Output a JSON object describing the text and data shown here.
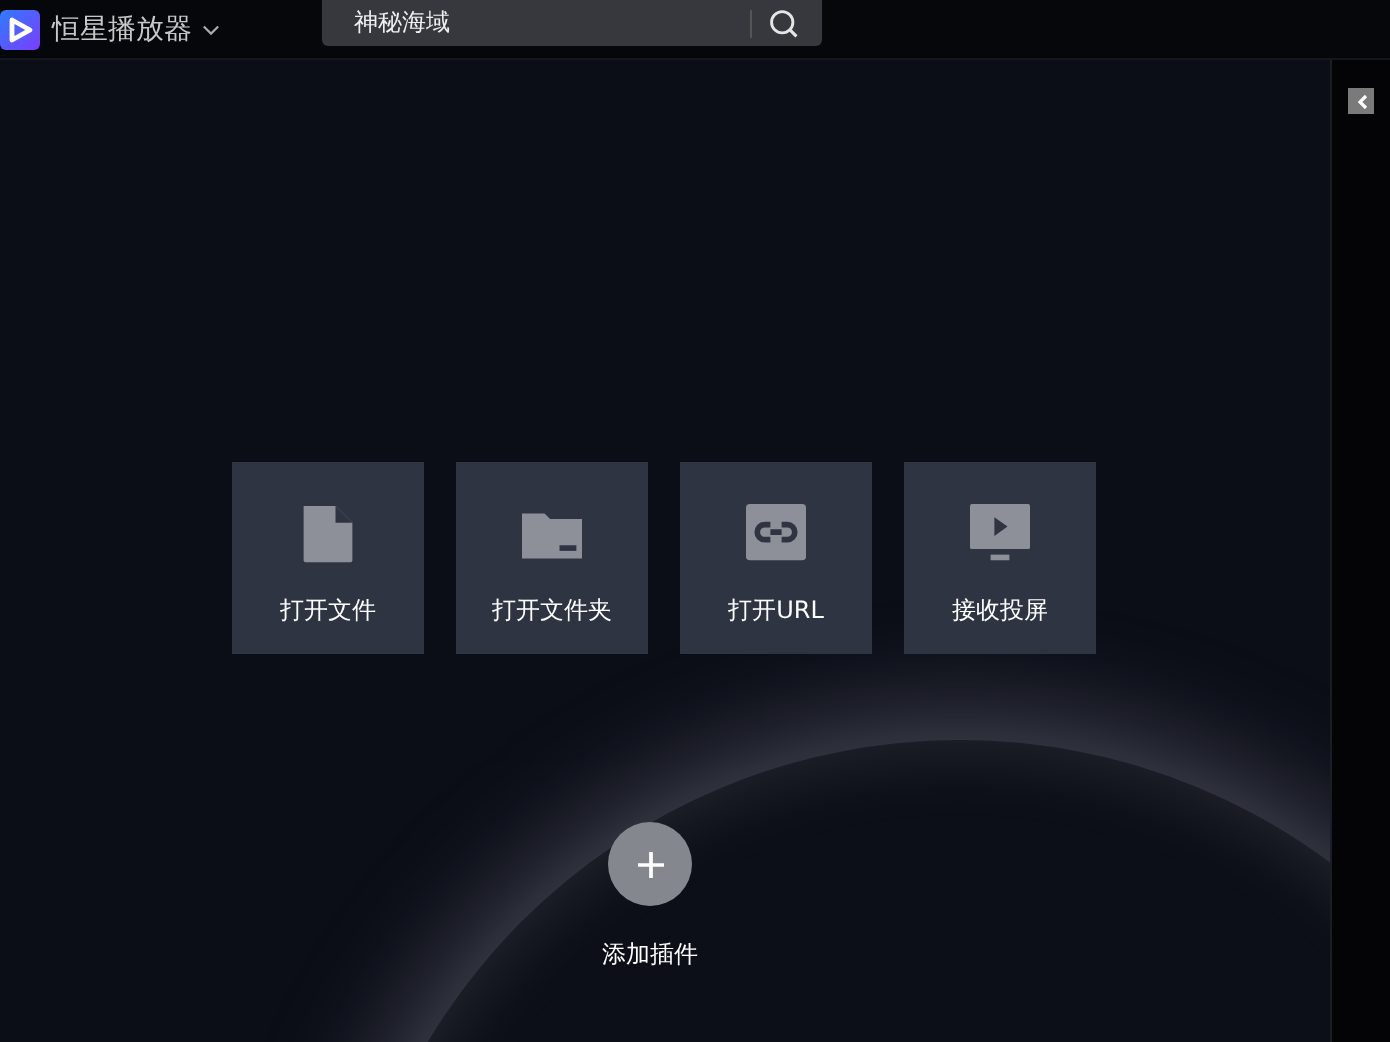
{
  "app": {
    "title": "恒星播放器"
  },
  "search": {
    "value": "神秘海域"
  },
  "actions": [
    {
      "kind": "file",
      "label": "打开文件"
    },
    {
      "kind": "folder",
      "label": "打开文件夹"
    },
    {
      "kind": "url",
      "label": "打开URL"
    },
    {
      "kind": "cast",
      "label": "接收投屏"
    }
  ],
  "add_plugin": {
    "label": "添加插件"
  }
}
